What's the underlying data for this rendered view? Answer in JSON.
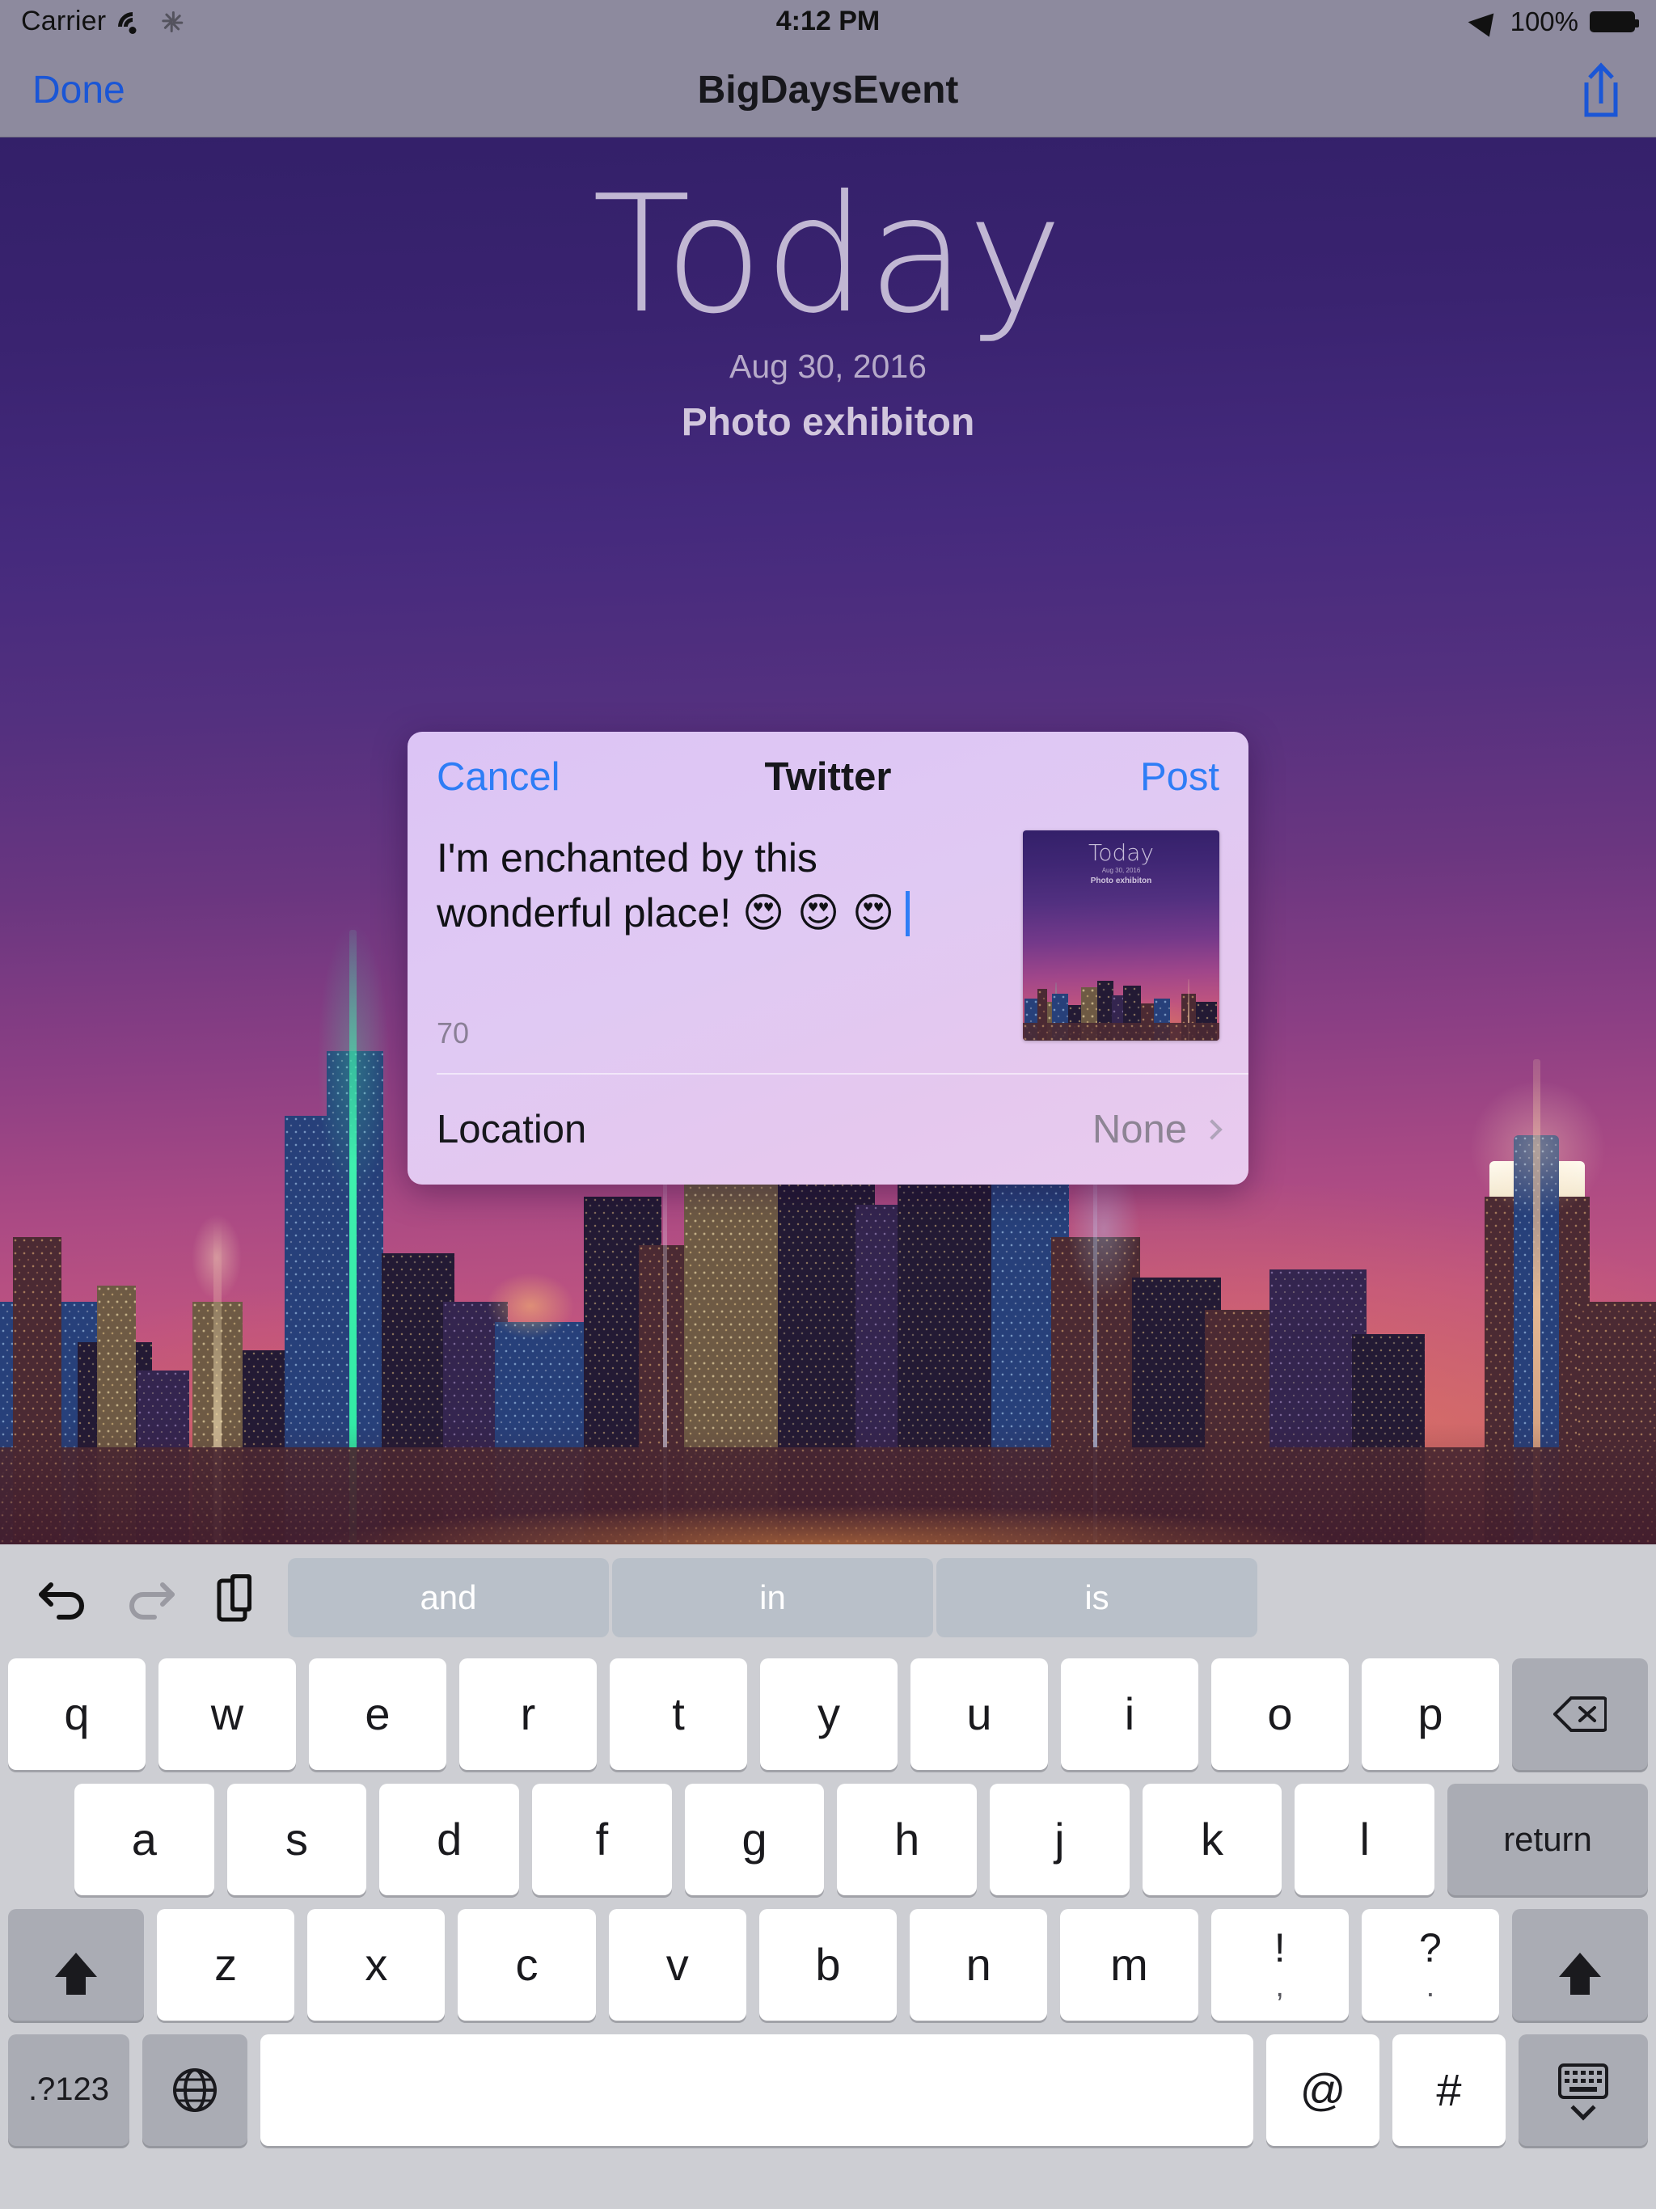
{
  "status_bar": {
    "carrier": "Carrier",
    "wifi_icon": "wifi-icon",
    "activity_icon": "activity-spinner-icon",
    "time": "4:12 PM",
    "location_icon": "location-arrow-icon",
    "battery_percent": "100%",
    "battery_icon": "battery-full-icon"
  },
  "nav_bar": {
    "done_label": "Done",
    "title": "BigDaysEvent",
    "share_icon": "share-icon"
  },
  "hero": {
    "title": "Today",
    "date": "Aug 30, 2016",
    "subtitle": "Photo exhibiton"
  },
  "compose_sheet": {
    "cancel_label": "Cancel",
    "title": "Twitter",
    "post_label": "Post",
    "tweet_text": "I'm enchanted by this wonderful place! ",
    "tweet_emoji": "😍 😍 😍",
    "char_count": "70",
    "thumbnail": {
      "title": "Today",
      "date": "Aug 30, 2016",
      "subtitle": "Photo exhibiton"
    },
    "location_label": "Location",
    "location_value": "None",
    "chevron_icon": "chevron-right-icon"
  },
  "keyboard": {
    "toolbar": {
      "undo_icon": "undo-arrow-icon",
      "redo_icon": "redo-arrow-icon",
      "paste_icon": "paste-clipboard-icon"
    },
    "suggestions": [
      "and",
      "in",
      "is"
    ],
    "row1": [
      "q",
      "w",
      "e",
      "r",
      "t",
      "y",
      "u",
      "i",
      "o",
      "p"
    ],
    "delete_icon": "delete-backspace-icon",
    "row2": [
      "a",
      "s",
      "d",
      "f",
      "g",
      "h",
      "j",
      "k",
      "l"
    ],
    "return_label": "return",
    "shift_icon": "shift-arrow-icon",
    "row3": [
      "z",
      "x",
      "c",
      "v",
      "b",
      "n",
      "m"
    ],
    "punct_excl_top": "!",
    "punct_excl_bottom": ",",
    "punct_ques_top": "?",
    "punct_ques_bottom": ".",
    "numeric_label": ".?123",
    "globe_icon": "globe-language-icon",
    "space_label": "",
    "at_key": "@",
    "hash_key": "#",
    "hide_keyboard_icon": "hide-keyboard-icon"
  },
  "colors": {
    "accent_blue": "#2e7df6",
    "nav_blue": "#1a56d6",
    "sheet_bg": "#e0c9f3",
    "status_bar_bg": "#8d8a9e",
    "keyboard_bg": "#cdced3",
    "suggestion_bg": "#b9c0c9"
  }
}
